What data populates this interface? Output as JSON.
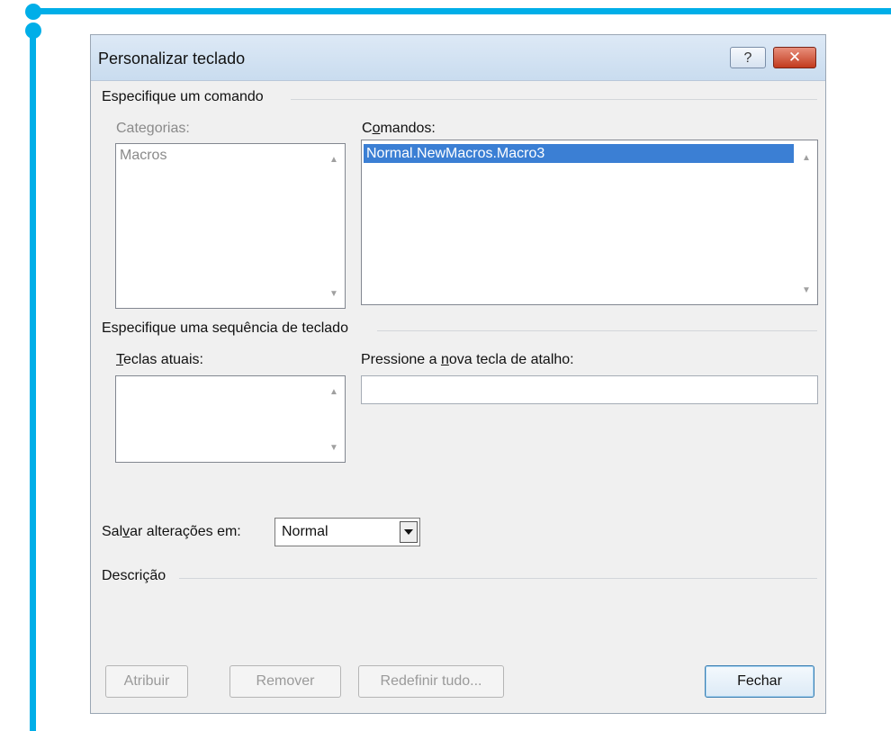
{
  "window": {
    "title": "Personalizar teclado",
    "help": "?",
    "close": "✕"
  },
  "command_section": {
    "header": "Especifique um comando",
    "categories_label": "Categorias:",
    "categories": [
      "Macros"
    ],
    "commands_label_pre": "C",
    "commands_label_u": "o",
    "commands_label_post": "mandos:",
    "commands": [
      "Normal.NewMacros.Macro3"
    ]
  },
  "keyboard_section": {
    "header": "Especifique uma sequência de teclado",
    "current_keys_label_u": "T",
    "current_keys_label_post": "eclas atuais:",
    "new_key_label_pre": "Pressione a ",
    "new_key_label_u": "n",
    "new_key_label_post": "ova tecla de atalho:",
    "new_key_value": ""
  },
  "save": {
    "label_pre": "Sal",
    "label_u": "v",
    "label_post": "ar alterações em:",
    "value": "Normal"
  },
  "description": {
    "header": "Descrição"
  },
  "buttons": {
    "assign": "Atribuir",
    "remove": "Remover",
    "reset_all": "Redefinir tudo...",
    "close": "Fechar"
  },
  "colors": {
    "accent_frame": "#00aee8",
    "selection": "#3b7fd4"
  }
}
